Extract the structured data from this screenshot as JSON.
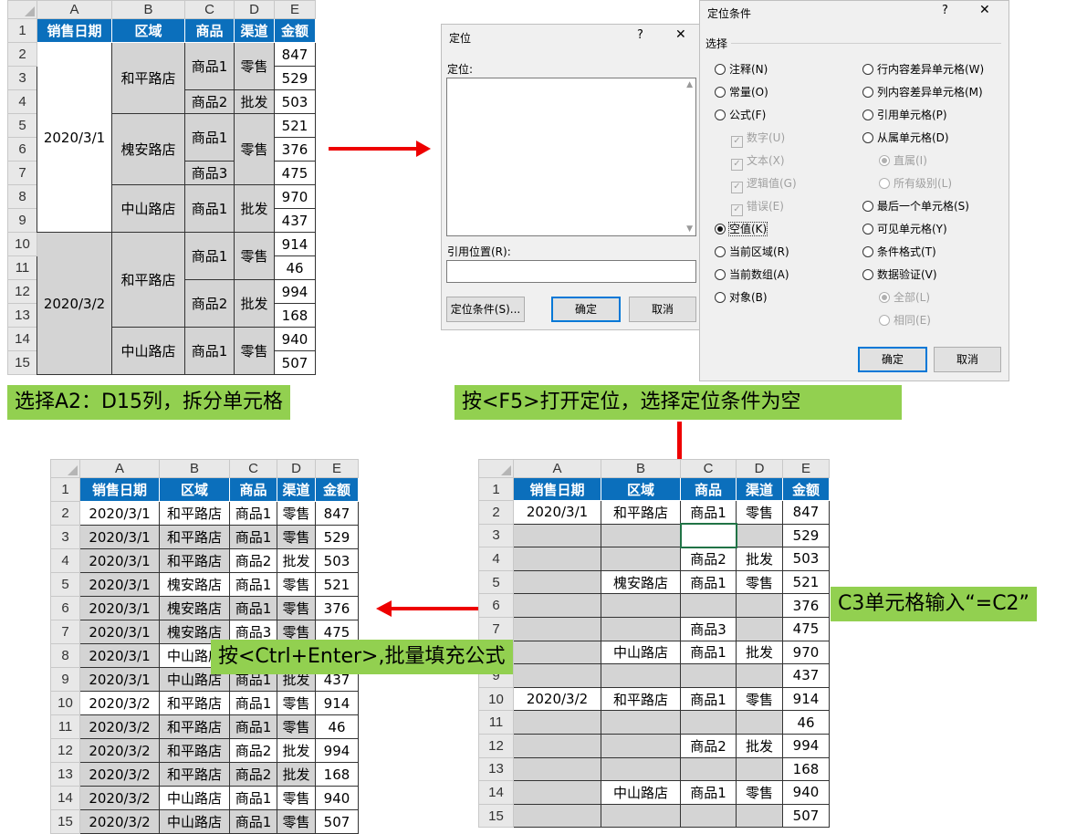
{
  "colors": {
    "header_blue": "#0b6fbc",
    "gray_fill": "#d4d4d4",
    "caption_green": "#92d050",
    "arrow_red": "#e00000"
  },
  "sheet1": {
    "col_letters": [
      "A",
      "B",
      "C",
      "D",
      "E"
    ],
    "headers": [
      "销售日期",
      "区域",
      "商品",
      "渠道",
      "金额"
    ],
    "row_numbers": [
      "1",
      "2",
      "3",
      "4",
      "5",
      "6",
      "7",
      "8",
      "9",
      "10",
      "11",
      "12",
      "13",
      "14",
      "15"
    ],
    "dates": [
      "2020/3/1",
      "2020/3/2"
    ],
    "regions": [
      "和平路店",
      "槐安路店",
      "中山路店",
      "和平路店",
      "中山路店"
    ],
    "products": [
      "商品1",
      "商品2",
      "商品1",
      "商品3",
      "商品1",
      "商品1",
      "商品2",
      "商品1"
    ],
    "channels": [
      "零售",
      "批发",
      "零售",
      "批发",
      "零售",
      "批发",
      "零售"
    ],
    "amounts": [
      "847",
      "529",
      "503",
      "521",
      "376",
      "475",
      "970",
      "437",
      "914",
      "46",
      "994",
      "168",
      "940",
      "507"
    ]
  },
  "caption1": "选择A2：D15列，拆分单元格",
  "caption2": "按<F5>打开定位，选择定位条件为空",
  "caption3": "C3单元格输入“=C2”",
  "caption4": "按<Ctrl+Enter>,批量填充公式",
  "goto_dialog": {
    "title": "定位",
    "help": "?",
    "close": "✕",
    "label_goto": "定位:",
    "label_ref": "引用位置(R):",
    "btn_special": "定位条件(S)...",
    "btn_ok": "确定",
    "btn_cancel": "取消"
  },
  "special_dialog": {
    "title": "定位条件",
    "help": "?",
    "close": "✕",
    "section": "选择",
    "left": [
      "注释(N)",
      "常量(O)",
      "公式(F)",
      "空值(K)",
      "当前区域(R)",
      "当前数组(A)",
      "对象(B)"
    ],
    "checks": [
      "数字(U)",
      "文本(X)",
      "逻辑值(G)",
      "错误(E)"
    ],
    "right": [
      "行内容差异单元格(W)",
      "列内容差异单元格(M)",
      "引用单元格(P)",
      "从属单元格(D)",
      "直属(I)",
      "所有级别(L)",
      "最后一个单元格(S)",
      "可见单元格(Y)",
      "条件格式(T)",
      "数据验证(V)",
      "全部(L)",
      "相同(E)"
    ],
    "btn_ok": "确定",
    "btn_cancel": "取消"
  },
  "sheet2": {
    "rows": [
      [
        "2020/3/1",
        "和平路店",
        "商品1",
        "零售",
        "847"
      ],
      [
        "",
        "",
        "",
        "",
        "529"
      ],
      [
        "",
        "",
        "商品2",
        "批发",
        "503"
      ],
      [
        "",
        "槐安路店",
        "商品1",
        "零售",
        "521"
      ],
      [
        "",
        "",
        "",
        "",
        "376"
      ],
      [
        "",
        "",
        "商品3",
        "",
        "475"
      ],
      [
        "",
        "中山路店",
        "商品1",
        "批发",
        "970"
      ],
      [
        "",
        "",
        "",
        "",
        "437"
      ],
      [
        "2020/3/2",
        "和平路店",
        "商品1",
        "零售",
        "914"
      ],
      [
        "",
        "",
        "",
        "",
        "46"
      ],
      [
        "",
        "",
        "商品2",
        "批发",
        "994"
      ],
      [
        "",
        "",
        "",
        "",
        "168"
      ],
      [
        "",
        "中山路店",
        "商品1",
        "零售",
        "940"
      ],
      [
        "",
        "",
        "",
        "",
        "507"
      ]
    ]
  },
  "sheet3": {
    "rows": [
      [
        "2020/3/1",
        "和平路店",
        "商品1",
        "零售",
        "847"
      ],
      [
        "2020/3/1",
        "和平路店",
        "商品1",
        "零售",
        "529"
      ],
      [
        "2020/3/1",
        "和平路店",
        "商品2",
        "批发",
        "503"
      ],
      [
        "2020/3/1",
        "槐安路店",
        "商品1",
        "零售",
        "521"
      ],
      [
        "2020/3/1",
        "槐安路店",
        "商品1",
        "零售",
        "376"
      ],
      [
        "2020/3/1",
        "槐安路店",
        "商品3",
        "零售",
        "475"
      ],
      [
        "2020/3/1",
        "中山路店",
        "商品1",
        "批发",
        "970"
      ],
      [
        "2020/3/1",
        "中山路店",
        "商品1",
        "批发",
        "437"
      ],
      [
        "2020/3/2",
        "和平路店",
        "商品1",
        "零售",
        "914"
      ],
      [
        "2020/3/2",
        "和平路店",
        "商品1",
        "零售",
        "46"
      ],
      [
        "2020/3/2",
        "和平路店",
        "商品2",
        "批发",
        "994"
      ],
      [
        "2020/3/2",
        "和平路店",
        "商品2",
        "批发",
        "168"
      ],
      [
        "2020/3/2",
        "中山路店",
        "商品1",
        "零售",
        "940"
      ],
      [
        "2020/3/2",
        "中山路店",
        "商品1",
        "零售",
        "507"
      ]
    ]
  }
}
